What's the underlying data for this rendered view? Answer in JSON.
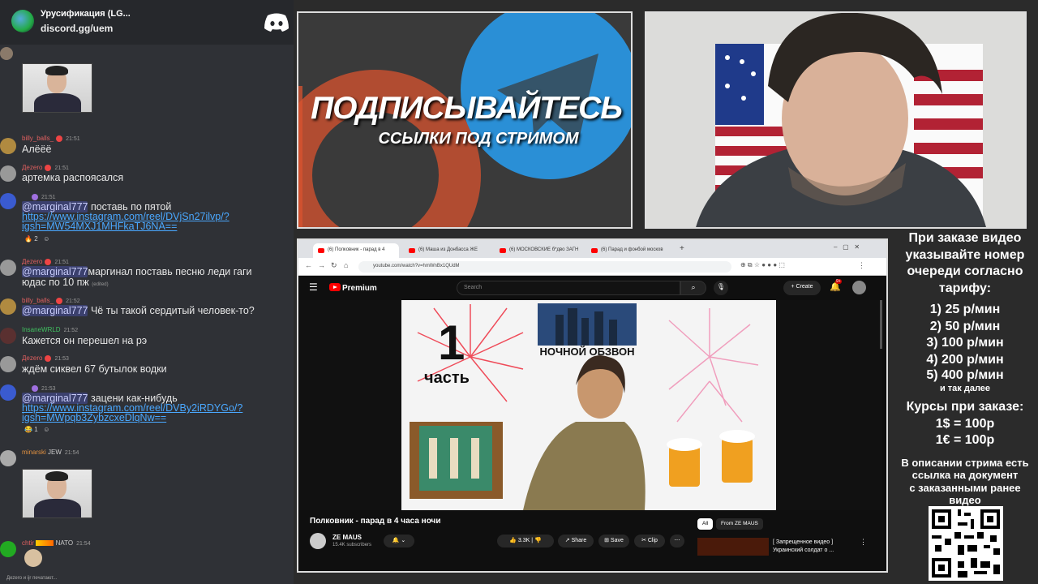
{
  "discord": {
    "server_name": "Урусификация (LG...",
    "invite": "discord.gg/uem",
    "messages": [
      {
        "user": "billy_balls_",
        "time": "21:51",
        "text": "Алёёё"
      },
      {
        "user": "Дezero",
        "time": "21:51",
        "text": "артемка распоясался"
      },
      {
        "user": "",
        "time": "21:51",
        "mention": "@marginal777",
        "text": " поставь по пятой",
        "link1": "https://www.instagram.com/reel/DVjSn27ilvp/?",
        "link2": "igsh=MW54MXJ1MHFkaTJ6NA==",
        "reactions": [
          "2"
        ]
      },
      {
        "user": "Дezero",
        "time": "21:51",
        "mention": "@marginal777",
        "text": "маргинал поставь песню леди гаги",
        "text2": "юдас по 10 пж",
        "edited": "(edited)"
      },
      {
        "user": "billy_balls_",
        "time": "21:52",
        "mention": "@marginal777",
        "text": " Чё ты такой сердитый человек-то?"
      },
      {
        "user": "InsaneWRLD",
        "time": "21:52",
        "text": "Кажется он перешел на рэ"
      },
      {
        "user": "Дezero",
        "time": "21:53",
        "text": "ждём сиквел 67 бутылок водки"
      },
      {
        "user": "",
        "time": "21:53",
        "mention": "@marginal777",
        "text": " зацени как-нибудь",
        "link1": "https://www.instagram.com/reel/DVBy2iRDYGo/?",
        "link2": "igsh=MWpqb3ZybzcxeDlqNw==",
        "reactions": [
          "1"
        ]
      },
      {
        "user": "minarski",
        "tag": "JEW",
        "time": "21:54"
      },
      {
        "user": "chtir",
        "tag": "NATO",
        "time": "21:54"
      }
    ],
    "typing": "Дezero и ijr печатают..."
  },
  "banner": {
    "line1": "ПОДПИСЫВАЙТЕСЬ",
    "line2": "ССЫЛКИ ПОД СТРИМОМ"
  },
  "browser": {
    "tabs": [
      "(6) Полковник - парад в 4",
      "(6) Маша из Донбасса ЖЕ",
      "(6) МОСКОВСКИЕ б*дво ЗАГН",
      "(6) Парад и фонбой москов"
    ],
    "url": "youtube.com/watch?v=hmWnBx1QUdM",
    "youtube": {
      "logo": "Premium",
      "search_placeholder": "Search",
      "create": "Create",
      "notif_count": "9+",
      "video_text_top": "НОЧНОЙ ОБЗВОН",
      "video_part_num": "1",
      "video_part_word": "часть",
      "video_title": "Полковник - парад в 4 часа ночи",
      "channel": "ZE MAUS",
      "subs": "15.4K subscribers",
      "likes": "3.3K",
      "share": "Share",
      "save": "Save",
      "clip": "Clip",
      "chip_all": "All",
      "chip_from": "From ZE MAUS",
      "side_title_1": "[ Запрещенное видео ]",
      "side_title_2": "Украинский солдат о ..."
    }
  },
  "info": {
    "l1": "При заказе видео",
    "l2": "указывайте номер",
    "l3": "очереди согласно",
    "l4": "тарифу:",
    "t1": "1) 25 р/мин",
    "t2": "2) 50 р/мин",
    "t3": "3) 100 р/мин",
    "t4": "4) 200 р/мин",
    "t5": "5) 400 р/мин",
    "etc": "и так далее",
    "k0": "Курсы при заказе:",
    "k1": "1$ = 100р",
    "k2": "1€ = 100р",
    "d1": "В описании стрима есть",
    "d2": "ссылка на документ",
    "d3": "с заказанными ранее",
    "d4": "видео"
  },
  "colors": {
    "discord_bg": "#2f3136",
    "link": "#4aa8ff",
    "yt_red": "#ff0000",
    "telegram_blue": "#2a8fd6",
    "patreon_orange": "#d9532f"
  }
}
